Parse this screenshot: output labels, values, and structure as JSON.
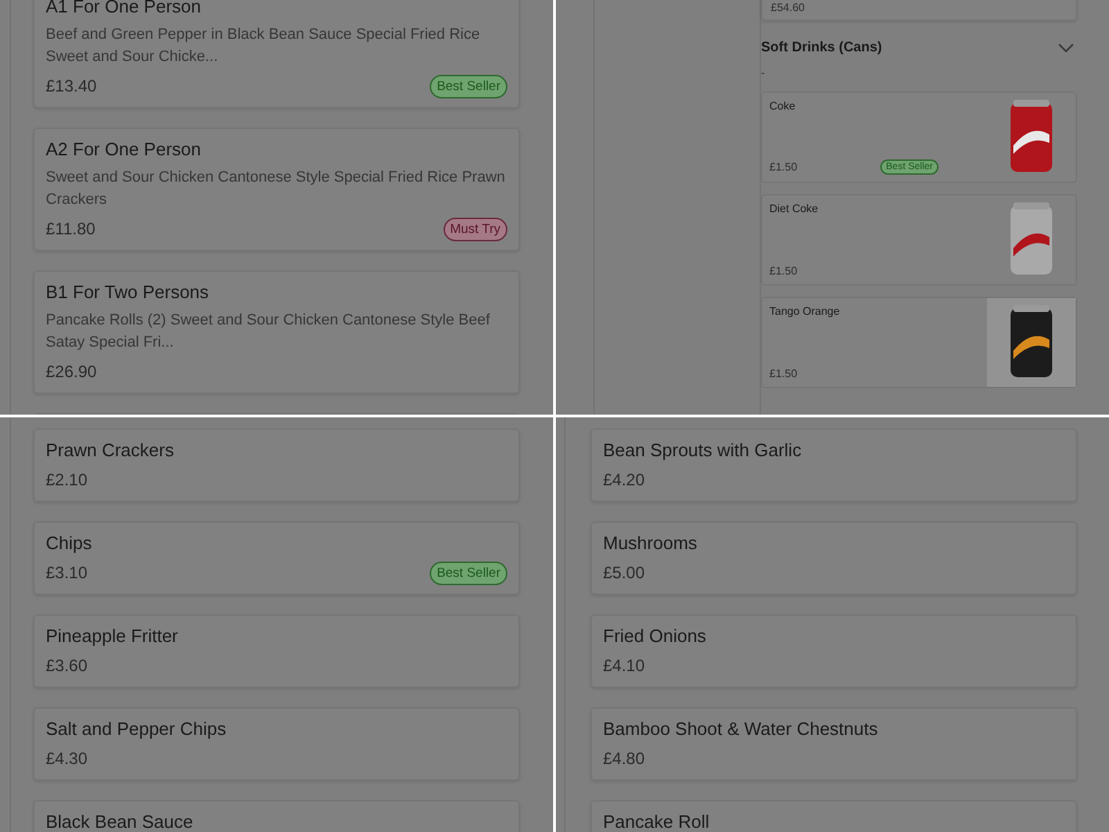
{
  "panels": [
    {
      "kind": "meals",
      "items": [
        {
          "name": "A1 For One Person",
          "description": "Beef and Green Pepper in Black Bean Sauce Special Fried Rice Sweet and Sour Chicke...",
          "price": "£13.40",
          "badge": {
            "kind": "best",
            "label": "Best Seller"
          }
        },
        {
          "name": "A2 For One Person",
          "description": "Sweet and Sour Chicken Cantonese Style Special Fried Rice Prawn Crackers",
          "price": "£11.80",
          "badge": {
            "kind": "must",
            "label": "Must Try"
          }
        },
        {
          "name": "B1 For Two Persons",
          "description": "Pancake Rolls (2) Sweet and Sour Chicken Cantonese Style Beef Satay Special Fri...",
          "price": "£26.90"
        }
      ],
      "more_below": true
    },
    {
      "kind": "drinks",
      "partial_price": "£54.60",
      "section": {
        "title": "Soft Drinks (Cans)",
        "expanded": true
      },
      "marker": "-",
      "items": [
        {
          "name": "Coke",
          "price": "£1.50",
          "badge": {
            "kind": "best",
            "label": "Best Seller"
          }
        },
        {
          "name": "Diet Coke",
          "price": "£1.50"
        },
        {
          "name": "Tango Orange",
          "price": "£1.50"
        }
      ]
    },
    {
      "kind": "meals",
      "items": [
        {
          "name": "Prawn Crackers",
          "price": "£2.10"
        },
        {
          "name": "Chips",
          "price": "£3.10",
          "badge": {
            "kind": "best",
            "label": "Best Seller"
          }
        },
        {
          "name": "Pineapple Fritter",
          "price": "£3.60"
        },
        {
          "name": "Salt and Pepper Chips",
          "price": "£4.30"
        },
        {
          "name": "Black Bean Sauce"
        }
      ]
    },
    {
      "kind": "meals",
      "items": [
        {
          "name": "Bean Sprouts with Garlic",
          "price": "£4.20"
        },
        {
          "name": "Mushrooms",
          "price": "£5.00"
        },
        {
          "name": "Fried Onions",
          "price": "£4.10"
        },
        {
          "name": "Bamboo Shoot & Water Chestnuts",
          "price": "£4.80"
        },
        {
          "name": "Pancake Roll"
        }
      ]
    }
  ]
}
